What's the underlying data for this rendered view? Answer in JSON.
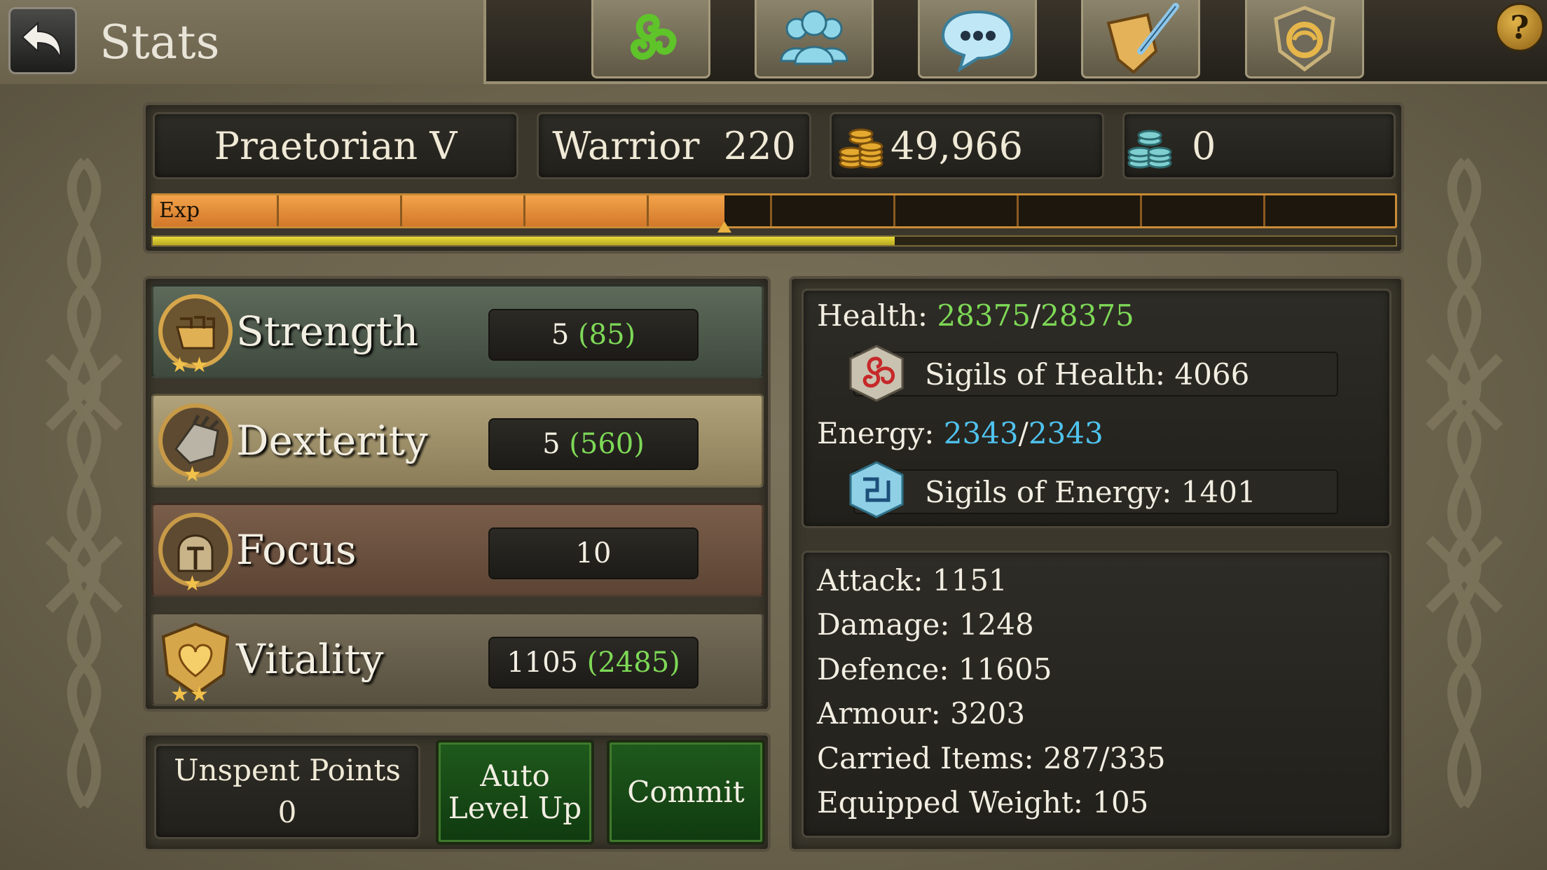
{
  "header": {
    "title": "Stats",
    "back_icon": "back-arrow-icon",
    "nav": [
      {
        "icon": "triskelion-icon"
      },
      {
        "icon": "friends-icon"
      },
      {
        "icon": "chat-icon"
      },
      {
        "icon": "quest-scroll-icon"
      },
      {
        "icon": "guild-crest-icon"
      }
    ],
    "help": "?"
  },
  "character": {
    "rank": "Praetorian V",
    "class_level": "Warrior  220",
    "gold": "49,966",
    "platinum": "0",
    "exp_label": "Exp",
    "exp_progress": 0.46,
    "sub_progress": 0.597
  },
  "stats": [
    {
      "name": "Strength",
      "base": "5",
      "total": "(85)",
      "icon": "strength-fist-icon"
    },
    {
      "name": "Dexterity",
      "base": "5",
      "total": "(560)",
      "icon": "dexterity-gauntlet-icon"
    },
    {
      "name": "Focus",
      "base": "10",
      "total": "",
      "icon": "focus-helmet-icon"
    },
    {
      "name": "Vitality",
      "base": "1105",
      "total": "(2485)",
      "icon": "vitality-heart-icon"
    }
  ],
  "vitals": {
    "health_label": "Health:",
    "health_current": "28375",
    "health_max": "28375",
    "sigils_health": "Sigils of Health: 4066",
    "energy_label": "Energy:",
    "energy_current": "2343",
    "energy_max": "2343",
    "sigils_energy": "Sigils of Energy: 1401",
    "slash": "/"
  },
  "combat": {
    "attack": "Attack: 1151",
    "damage": "Damage: 1248",
    "defence": "Defence: 11605",
    "armour": "Armour: 3203",
    "carried": "Carried Items: 287/335",
    "weight": "Equipped Weight: 105"
  },
  "footer": {
    "unspent_label": "Unspent Points",
    "unspent_value": "0",
    "auto_level_line1": "Auto",
    "auto_level_line2": "Level Up",
    "commit": "Commit"
  },
  "colors": {
    "accent_green": "#7ed957",
    "accent_blue": "#4fc3ee",
    "exp_orange": "#e88e38",
    "bar_yellow": "#e7dc3a"
  }
}
